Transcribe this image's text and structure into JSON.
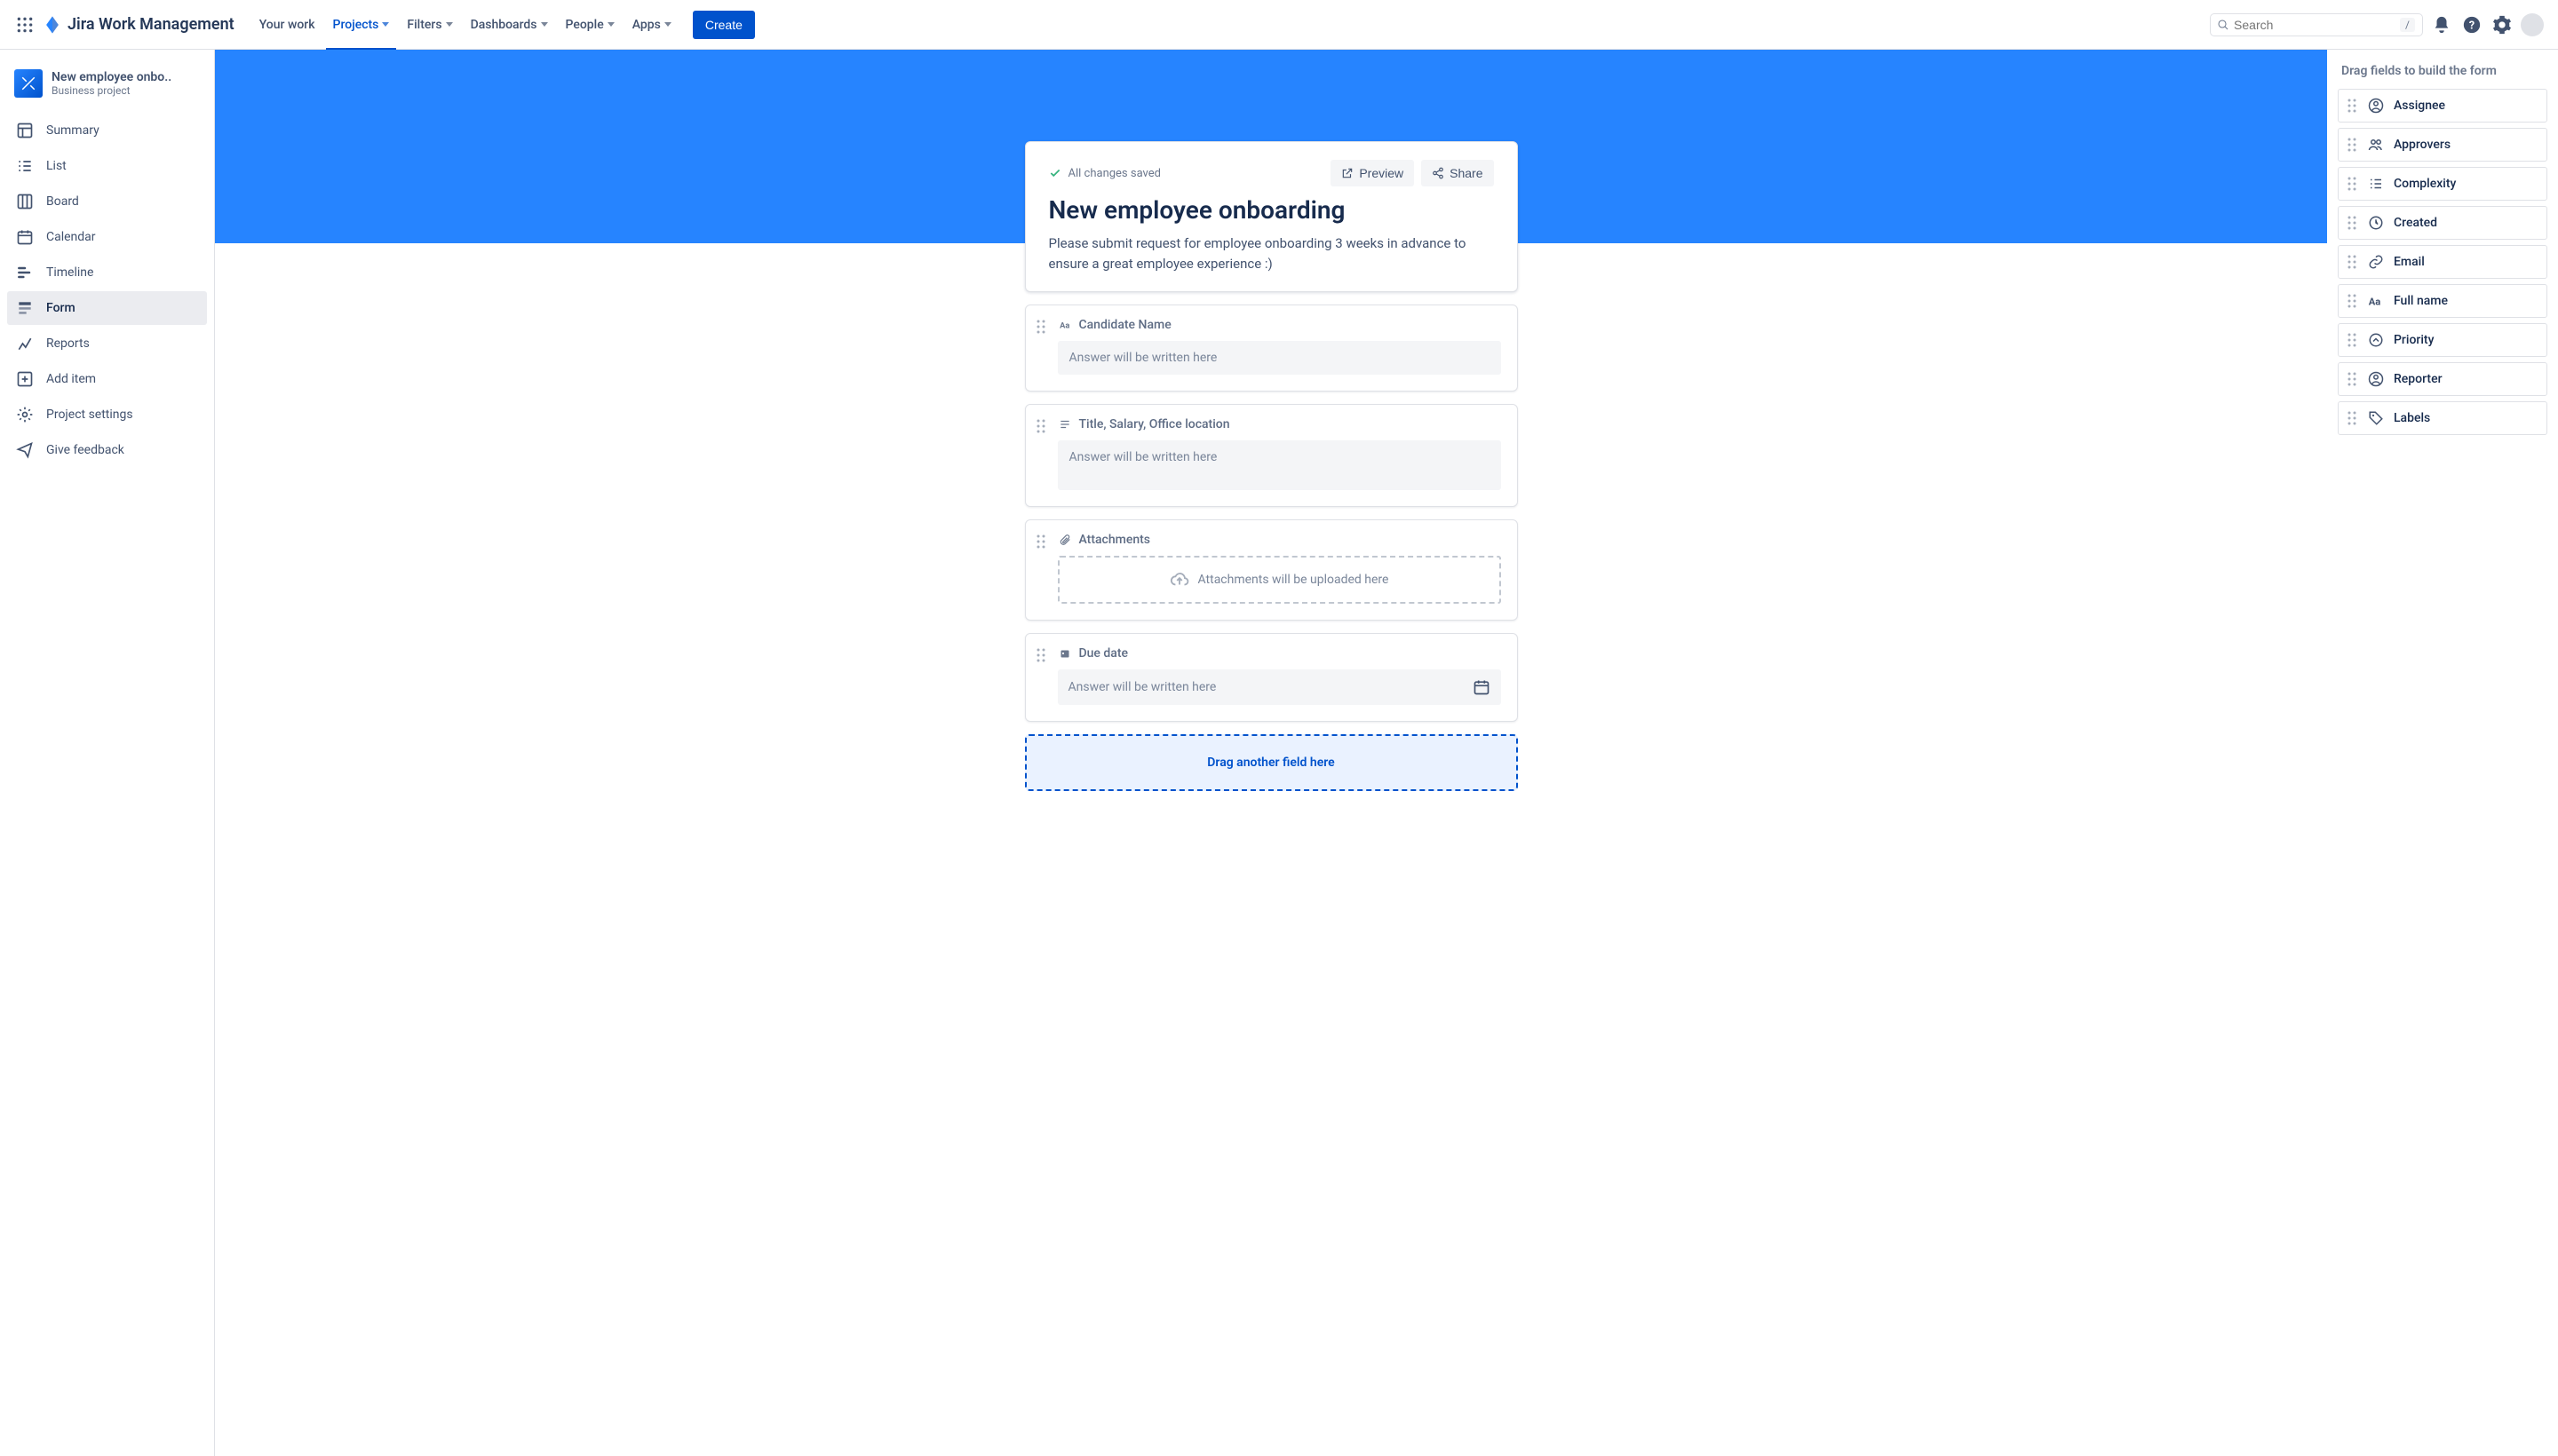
{
  "topnav": {
    "brand": "Jira Work Management",
    "items": [
      "Your work",
      "Projects",
      "Filters",
      "Dashboards",
      "People",
      "Apps"
    ],
    "active_index": 1,
    "create": "Create",
    "search_placeholder": "Search",
    "search_shortcut": "/"
  },
  "sidebar": {
    "project_name": "New employee onbo..",
    "project_type": "Business project",
    "items": [
      {
        "label": "Summary",
        "icon": "summary"
      },
      {
        "label": "List",
        "icon": "list"
      },
      {
        "label": "Board",
        "icon": "board"
      },
      {
        "label": "Calendar",
        "icon": "calendar"
      },
      {
        "label": "Timeline",
        "icon": "timeline"
      },
      {
        "label": "Form",
        "icon": "form"
      },
      {
        "label": "Reports",
        "icon": "reports"
      },
      {
        "label": "Add item",
        "icon": "add"
      },
      {
        "label": "Project settings",
        "icon": "settings"
      },
      {
        "label": "Give feedback",
        "icon": "feedback"
      }
    ],
    "active_index": 5
  },
  "form": {
    "saved_status": "All changes saved",
    "preview": "Preview",
    "share": "Share",
    "title": "New employee onboarding",
    "description": "Please submit request for employee onboarding 3 weeks in advance to ensure a great employee experience :)",
    "fields": [
      {
        "type": "text",
        "label": "Candidate Name",
        "placeholder": "Answer will be written here"
      },
      {
        "type": "paragraph",
        "label": "Title, Salary, Office location",
        "placeholder": "Answer will be written here"
      },
      {
        "type": "attachment",
        "label": "Attachments",
        "placeholder": "Attachments will be uploaded here"
      },
      {
        "type": "date",
        "label": "Due date",
        "placeholder": "Answer will be written here"
      }
    ],
    "dropzone": "Drag another field here"
  },
  "rail": {
    "title": "Drag fields to build the form",
    "fields": [
      {
        "label": "Assignee",
        "icon": "user"
      },
      {
        "label": "Approvers",
        "icon": "users"
      },
      {
        "label": "Complexity",
        "icon": "list"
      },
      {
        "label": "Created",
        "icon": "clock"
      },
      {
        "label": "Email",
        "icon": "link"
      },
      {
        "label": "Full name",
        "icon": "text"
      },
      {
        "label": "Priority",
        "icon": "priority"
      },
      {
        "label": "Reporter",
        "icon": "user"
      },
      {
        "label": "Labels",
        "icon": "tag"
      }
    ]
  }
}
